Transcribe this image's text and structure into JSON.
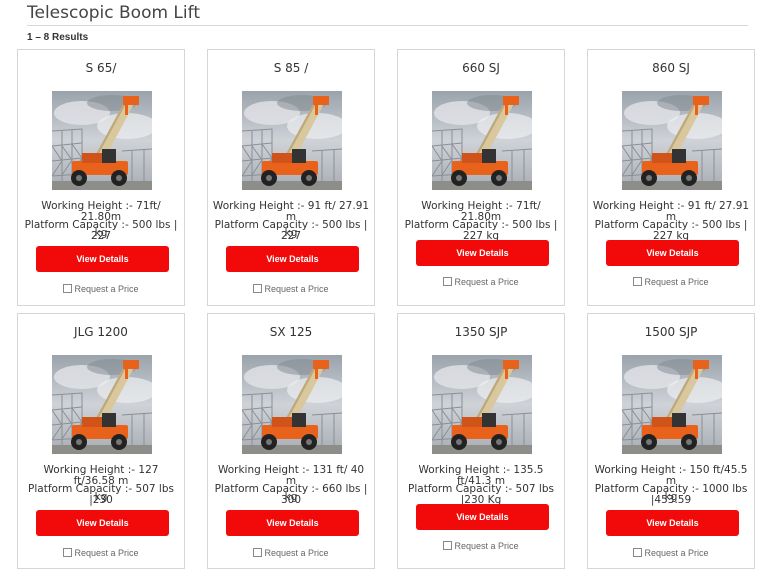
{
  "page": {
    "title": "Telescopic Boom Lift",
    "results": "1 – 8 Results"
  },
  "cards": [
    {
      "name": "S 65/",
      "height": "Working Height :- 71ft/ 21.80m",
      "cap1": "Platform Capacity :- 500 lbs | 227",
      "cap2": "kg",
      "button": "View Details",
      "rap": "Request a Price"
    },
    {
      "name": "S 85 /",
      "height": "Working Height :- 91 ft/ 27.91 m",
      "cap1": "Platform Capacity :- 500 lbs | 227",
      "cap2": "kg",
      "button": "View Details",
      "rap": "Request a Price"
    },
    {
      "name": "660 SJ",
      "height": "Working Height :- 71ft/ 21.80m",
      "cap1": "Platform Capacity :- 500 lbs | 227 kg",
      "cap2": "",
      "button": "View Details",
      "rap": "Request a Price"
    },
    {
      "name": "860 SJ",
      "height": "Working Height :- 91 ft/ 27.91 m",
      "cap1": "Platform Capacity :- 500 lbs | 227 kg",
      "cap2": "",
      "button": "View Details",
      "rap": "Request a Price"
    },
    {
      "name": "JLG 1200",
      "height": "Working Height :- 127 ft/36.58 m",
      "cap1": "Platform Capacity :- 507 lbs |230",
      "cap2": "kg",
      "button": "View Details",
      "rap": "Request a Price"
    },
    {
      "name": "SX 125",
      "height": "Working Height :- 131 ft/ 40 m",
      "cap1": "Platform Capacity :- 660 lbs | 300",
      "cap2": "kg",
      "button": "View Details",
      "rap": "Request a Price"
    },
    {
      "name": "1350 SJP",
      "height": "Working Height :- 135.5 ft/41.3 m",
      "cap1": "Platform Capacity :- 507 lbs |230 Kg",
      "cap2": "",
      "button": "View Details",
      "rap": "Request a Price"
    },
    {
      "name": "1500 SJP",
      "height": "Working Height :- 150 ft/45.5 m",
      "cap1": "Platform Capacity :- 1000 lbs |453.59",
      "cap2": "kg",
      "button": "View Details",
      "rap": "Request a Price"
    }
  ],
  "colors": {
    "button": "#f20a0a",
    "machine": "#e8621b",
    "boom": "#d8c6a0",
    "sky": "#b9bfc6"
  }
}
